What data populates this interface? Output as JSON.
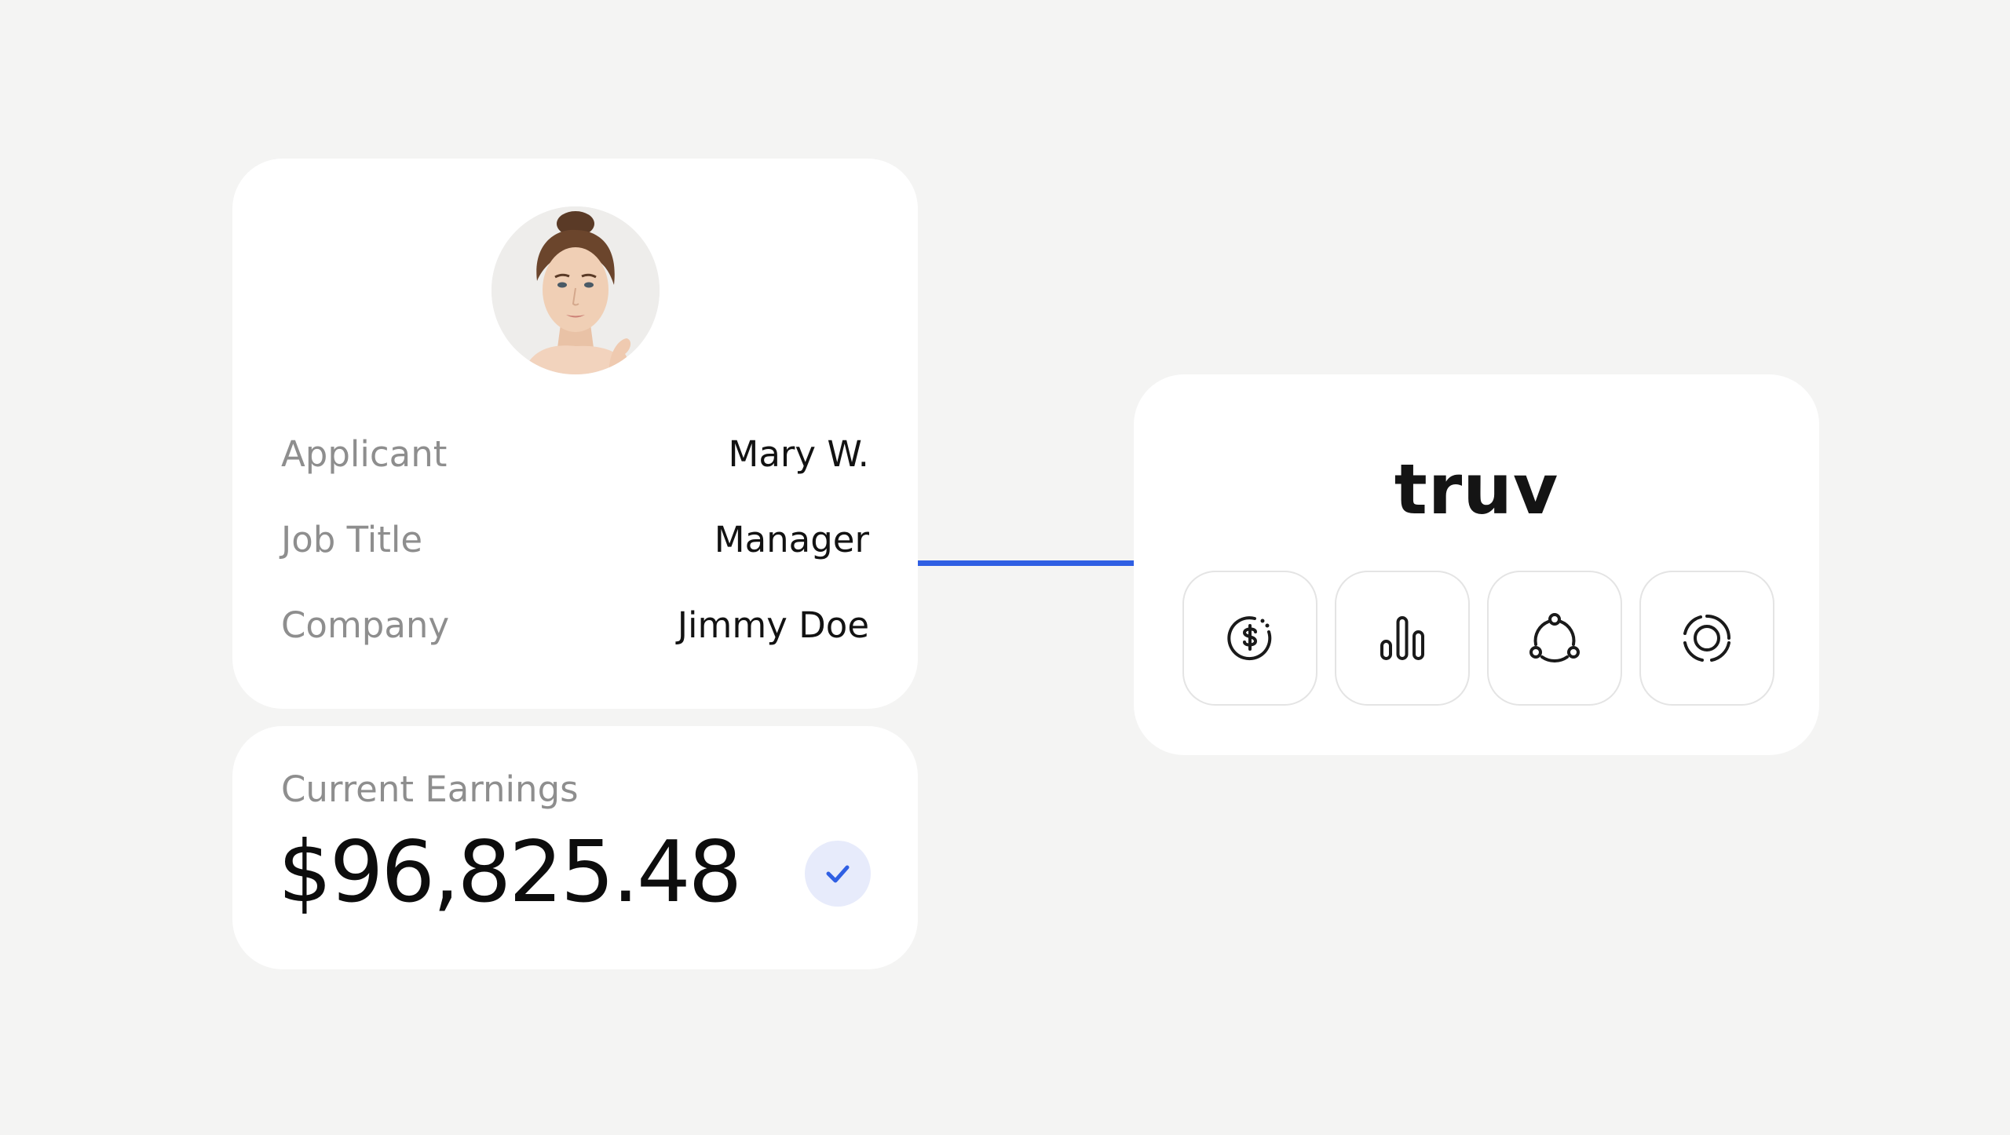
{
  "profile": {
    "applicant_label": "Applicant",
    "applicant_value": "Mary W.",
    "job_title_label": "Job Title",
    "job_title_value": "Manager",
    "company_label": "Company",
    "company_value": "Jimmy Doe"
  },
  "earnings": {
    "label": "Current Earnings",
    "value": "$96,825.48",
    "verified_icon": "check-icon"
  },
  "truv": {
    "logo": "truv",
    "icons": [
      "dollar-cycle-icon",
      "bar-chart-icon",
      "network-icon",
      "target-ring-icon"
    ]
  },
  "colors": {
    "background": "#f4f4f3",
    "card": "#ffffff",
    "accent_blue": "#2f5fe3",
    "badge_bg": "#e7ebfb",
    "label_gray": "#8e8e8e"
  }
}
